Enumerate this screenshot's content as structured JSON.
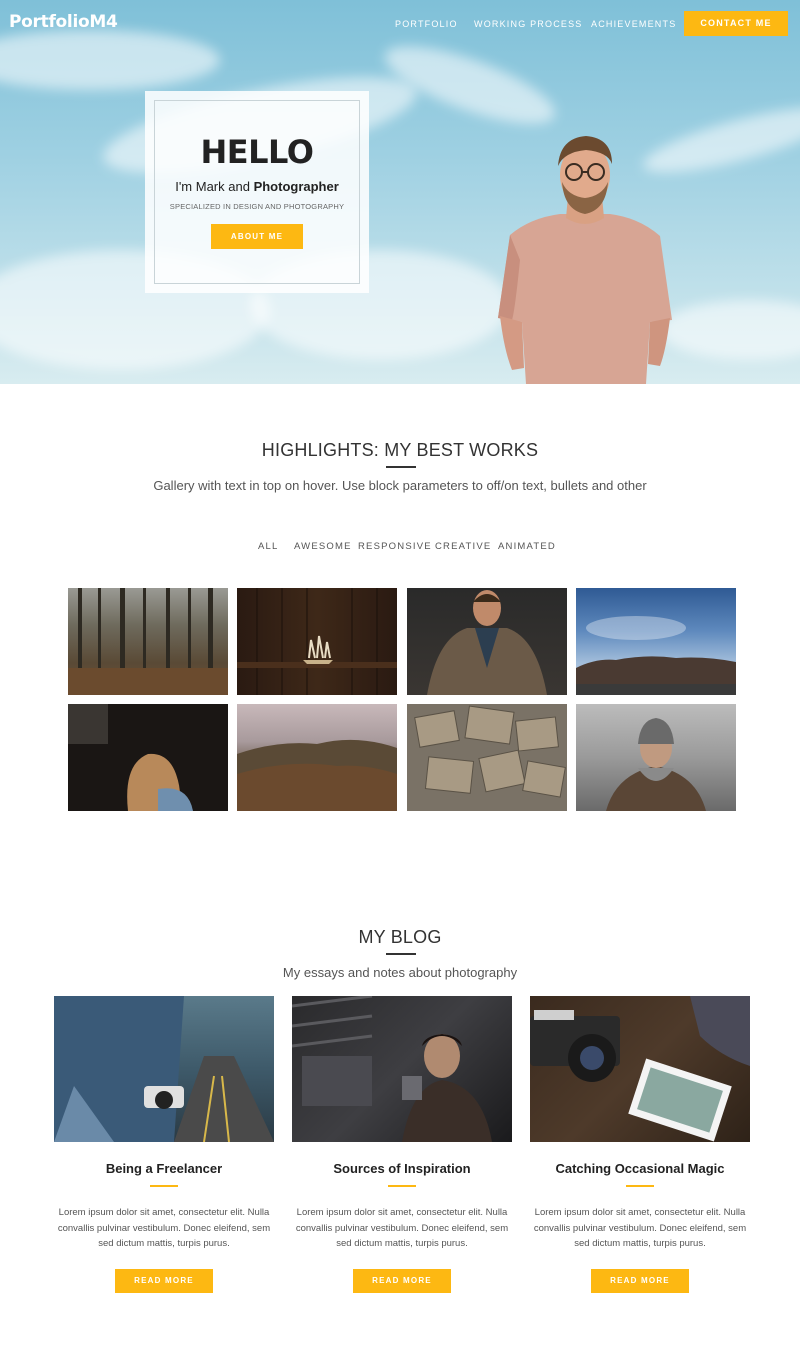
{
  "nav": {
    "logo": "PortfolioM4",
    "links": [
      "PORTFOLIO",
      "WORKING PROCESS",
      "ACHIEVEMENTS"
    ],
    "cta": "CONTACT ME"
  },
  "hero": {
    "title": "HELLO",
    "intro": "I'm Mark and",
    "role": "Photographer",
    "specialized": "SPECIALIZED IN DESIGN AND PHOTOGRAPHY",
    "button": "ABOUT ME"
  },
  "highlights": {
    "title": "HIGHLIGHTS: MY BEST WORKS",
    "subtitle": "Gallery with text in top on hover. Use block parameters to off/on text, bullets and other",
    "filters": [
      "ALL",
      "AWESOME",
      "RESPONSIVE",
      "CREATIVE",
      "ANIMATED"
    ]
  },
  "blog": {
    "title": "MY BLOG",
    "subtitle": "My essays and notes about photography",
    "posts": [
      {
        "title": "Being a Freelancer",
        "text": "Lorem ipsum dolor sit amet, consectetur elit. Nulla convallis pulvinar vestibulum. Donec eleifend, sem sed dictum mattis, turpis purus.",
        "button": "READ MORE"
      },
      {
        "title": "Sources of Inspiration",
        "text": "Lorem ipsum dolor sit amet, consectetur elit. Nulla convallis pulvinar vestibulum. Donec eleifend, sem sed dictum mattis, turpis purus.",
        "button": "READ MORE"
      },
      {
        "title": "Catching Occasional Magic",
        "text": "Lorem ipsum dolor sit amet, consectetur elit. Nulla convallis pulvinar vestibulum. Donec eleifend, sem sed dictum mattis, turpis purus.",
        "button": "READ MORE"
      }
    ]
  },
  "colors": {
    "accent": "#fdb812",
    "sky": "#8ecbe0"
  }
}
